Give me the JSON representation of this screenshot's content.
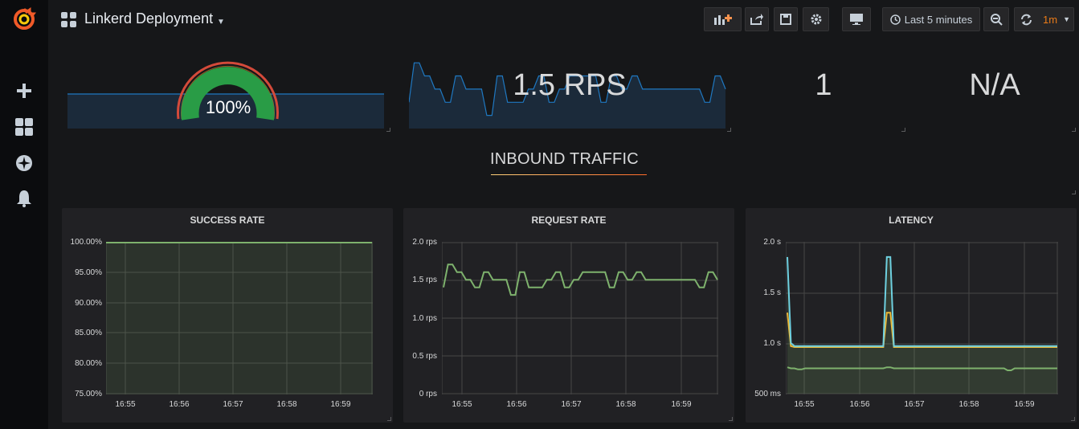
{
  "app": {
    "title": "Linkerd Deployment"
  },
  "sidebar": {
    "items": [
      "grafana-logo",
      "plus-icon",
      "dashboards-icon",
      "explore-icon",
      "alerting-icon"
    ]
  },
  "toolbar": {
    "time_range": "Last 5 minutes",
    "refresh_interval": "1m"
  },
  "stats": {
    "gauge": {
      "value_text": "100%",
      "value": 100
    },
    "rps": {
      "value_text": "1.5 RPS"
    },
    "count": {
      "value_text": "1"
    },
    "na": {
      "value_text": "N/A"
    }
  },
  "row": {
    "title": "INBOUND TRAFFIC"
  },
  "colors": {
    "green": "#7eb26d",
    "blue": "#6ed0e0",
    "yellow": "#eab839",
    "spark": "#1f78c1",
    "gauge_green": "#299c46",
    "gauge_red": "#d44a3a",
    "gauge_orange": "#ed8128"
  },
  "panels": {
    "success": {
      "title": "SUCCESS RATE",
      "yticks": [
        "100.00%",
        "95.00%",
        "90.00%",
        "85.00%",
        "80.00%",
        "75.00%"
      ],
      "xticks": [
        "16:55",
        "16:56",
        "16:57",
        "16:58",
        "16:59"
      ]
    },
    "request": {
      "title": "REQUEST RATE",
      "yticks": [
        "2.0 rps",
        "1.5 rps",
        "1.0 rps",
        "0.5 rps",
        "0 rps"
      ],
      "xticks": [
        "16:55",
        "16:56",
        "16:57",
        "16:58",
        "16:59"
      ]
    },
    "latency": {
      "title": "LATENCY",
      "yticks": [
        "2.0 s",
        "1.5 s",
        "1.0 s",
        "500 ms"
      ],
      "xticks": [
        "16:55",
        "16:56",
        "16:57",
        "16:58",
        "16:59"
      ]
    }
  },
  "chart_data": [
    {
      "type": "line",
      "title": "SUCCESS RATE",
      "x": [
        "16:54:45",
        "16:55:45",
        "16:56:45",
        "16:57:45",
        "16:58:45",
        "16:59:40"
      ],
      "series": [
        {
          "values": [
            100,
            100,
            100,
            100,
            100,
            100
          ]
        }
      ],
      "ylim": [
        75,
        100
      ],
      "grid": true
    },
    {
      "type": "line",
      "title": "REQUEST RATE",
      "series": [
        {
          "values": [
            1.4,
            1.7,
            1.7,
            1.6,
            1.6,
            1.5,
            1.5,
            1.4,
            1.4,
            1.6,
            1.6,
            1.5,
            1.5,
            1.5,
            1.5,
            1.3,
            1.3,
            1.6,
            1.6,
            1.4,
            1.4,
            1.4,
            1.4,
            1.5,
            1.5,
            1.6,
            1.6,
            1.4,
            1.4,
            1.5,
            1.5,
            1.6,
            1.6,
            1.6,
            1.6,
            1.6,
            1.6,
            1.4,
            1.4,
            1.6,
            1.6,
            1.5,
            1.5,
            1.6,
            1.6,
            1.5,
            1.5,
            1.5,
            1.5,
            1.5,
            1.5,
            1.5,
            1.5,
            1.5,
            1.5,
            1.5,
            1.5,
            1.4,
            1.4,
            1.6,
            1.6,
            1.5
          ]
        }
      ],
      "ylim": [
        0,
        2.0
      ],
      "grid": true
    },
    {
      "type": "line",
      "title": "LATENCY",
      "series": [
        {
          "values": [
            1.85,
            1.0,
            0.97,
            0.97,
            0.97,
            0.97,
            0.97,
            0.97,
            0.97,
            0.97,
            0.97,
            0.97,
            0.97,
            0.97,
            0.97,
            0.97,
            0.97,
            0.97,
            0.97,
            0.97,
            0.97,
            0.97,
            0.97,
            0.97,
            0.97,
            0.97,
            0.97,
            0.97,
            1.85,
            1.85,
            0.97,
            0.97,
            0.97,
            0.97,
            0.97,
            0.97,
            0.97,
            0.97,
            0.97,
            0.97,
            0.97,
            0.97,
            0.97,
            0.97,
            0.97,
            0.97,
            0.97,
            0.97,
            0.97,
            0.97,
            0.97,
            0.97,
            0.97,
            0.97,
            0.97,
            0.97,
            0.97,
            0.97,
            0.97,
            0.97,
            0.97,
            0.97,
            0.97,
            0.97,
            0.97,
            0.97,
            0.97,
            0.97,
            0.97,
            0.97,
            0.97,
            0.97,
            0.97,
            0.97,
            0.97,
            0.97,
            0.97
          ]
        },
        {
          "values": [
            1.3,
            0.97,
            0.96,
            0.96,
            0.96,
            0.96,
            0.96,
            0.96,
            0.96,
            0.96,
            0.96,
            0.96,
            0.96,
            0.96,
            0.96,
            0.96,
            0.96,
            0.96,
            0.96,
            0.96,
            0.96,
            0.96,
            0.96,
            0.96,
            0.96,
            0.96,
            0.96,
            0.96,
            1.3,
            1.3,
            0.96,
            0.96,
            0.96,
            0.96,
            0.96,
            0.96,
            0.96,
            0.96,
            0.96,
            0.96,
            0.96,
            0.96,
            0.96,
            0.96,
            0.96,
            0.96,
            0.96,
            0.96,
            0.96,
            0.96,
            0.96,
            0.96,
            0.96,
            0.96,
            0.96,
            0.96,
            0.96,
            0.96,
            0.96,
            0.96,
            0.96,
            0.96,
            0.96,
            0.96,
            0.96,
            0.96,
            0.96,
            0.96,
            0.96,
            0.96,
            0.96,
            0.96,
            0.96,
            0.96,
            0.96,
            0.96,
            0.96
          ]
        },
        {
          "values": [
            0.76,
            0.75,
            0.75,
            0.74,
            0.74,
            0.75,
            0.75,
            0.75,
            0.75,
            0.75,
            0.75,
            0.75,
            0.75,
            0.75,
            0.75,
            0.75,
            0.75,
            0.75,
            0.75,
            0.75,
            0.75,
            0.75,
            0.75,
            0.75,
            0.75,
            0.75,
            0.75,
            0.75,
            0.76,
            0.76,
            0.75,
            0.75,
            0.75,
            0.75,
            0.75,
            0.75,
            0.75,
            0.75,
            0.75,
            0.75,
            0.75,
            0.75,
            0.75,
            0.75,
            0.75,
            0.75,
            0.75,
            0.75,
            0.75,
            0.75,
            0.75,
            0.75,
            0.75,
            0.75,
            0.75,
            0.75,
            0.75,
            0.75,
            0.75,
            0.75,
            0.75,
            0.75,
            0.73,
            0.73,
            0.75,
            0.75,
            0.75,
            0.75,
            0.75,
            0.75,
            0.75,
            0.75,
            0.75,
            0.75,
            0.75,
            0.75,
            0.75
          ]
        }
      ],
      "ylim": [
        0.5,
        2.0
      ],
      "grid": true
    }
  ]
}
